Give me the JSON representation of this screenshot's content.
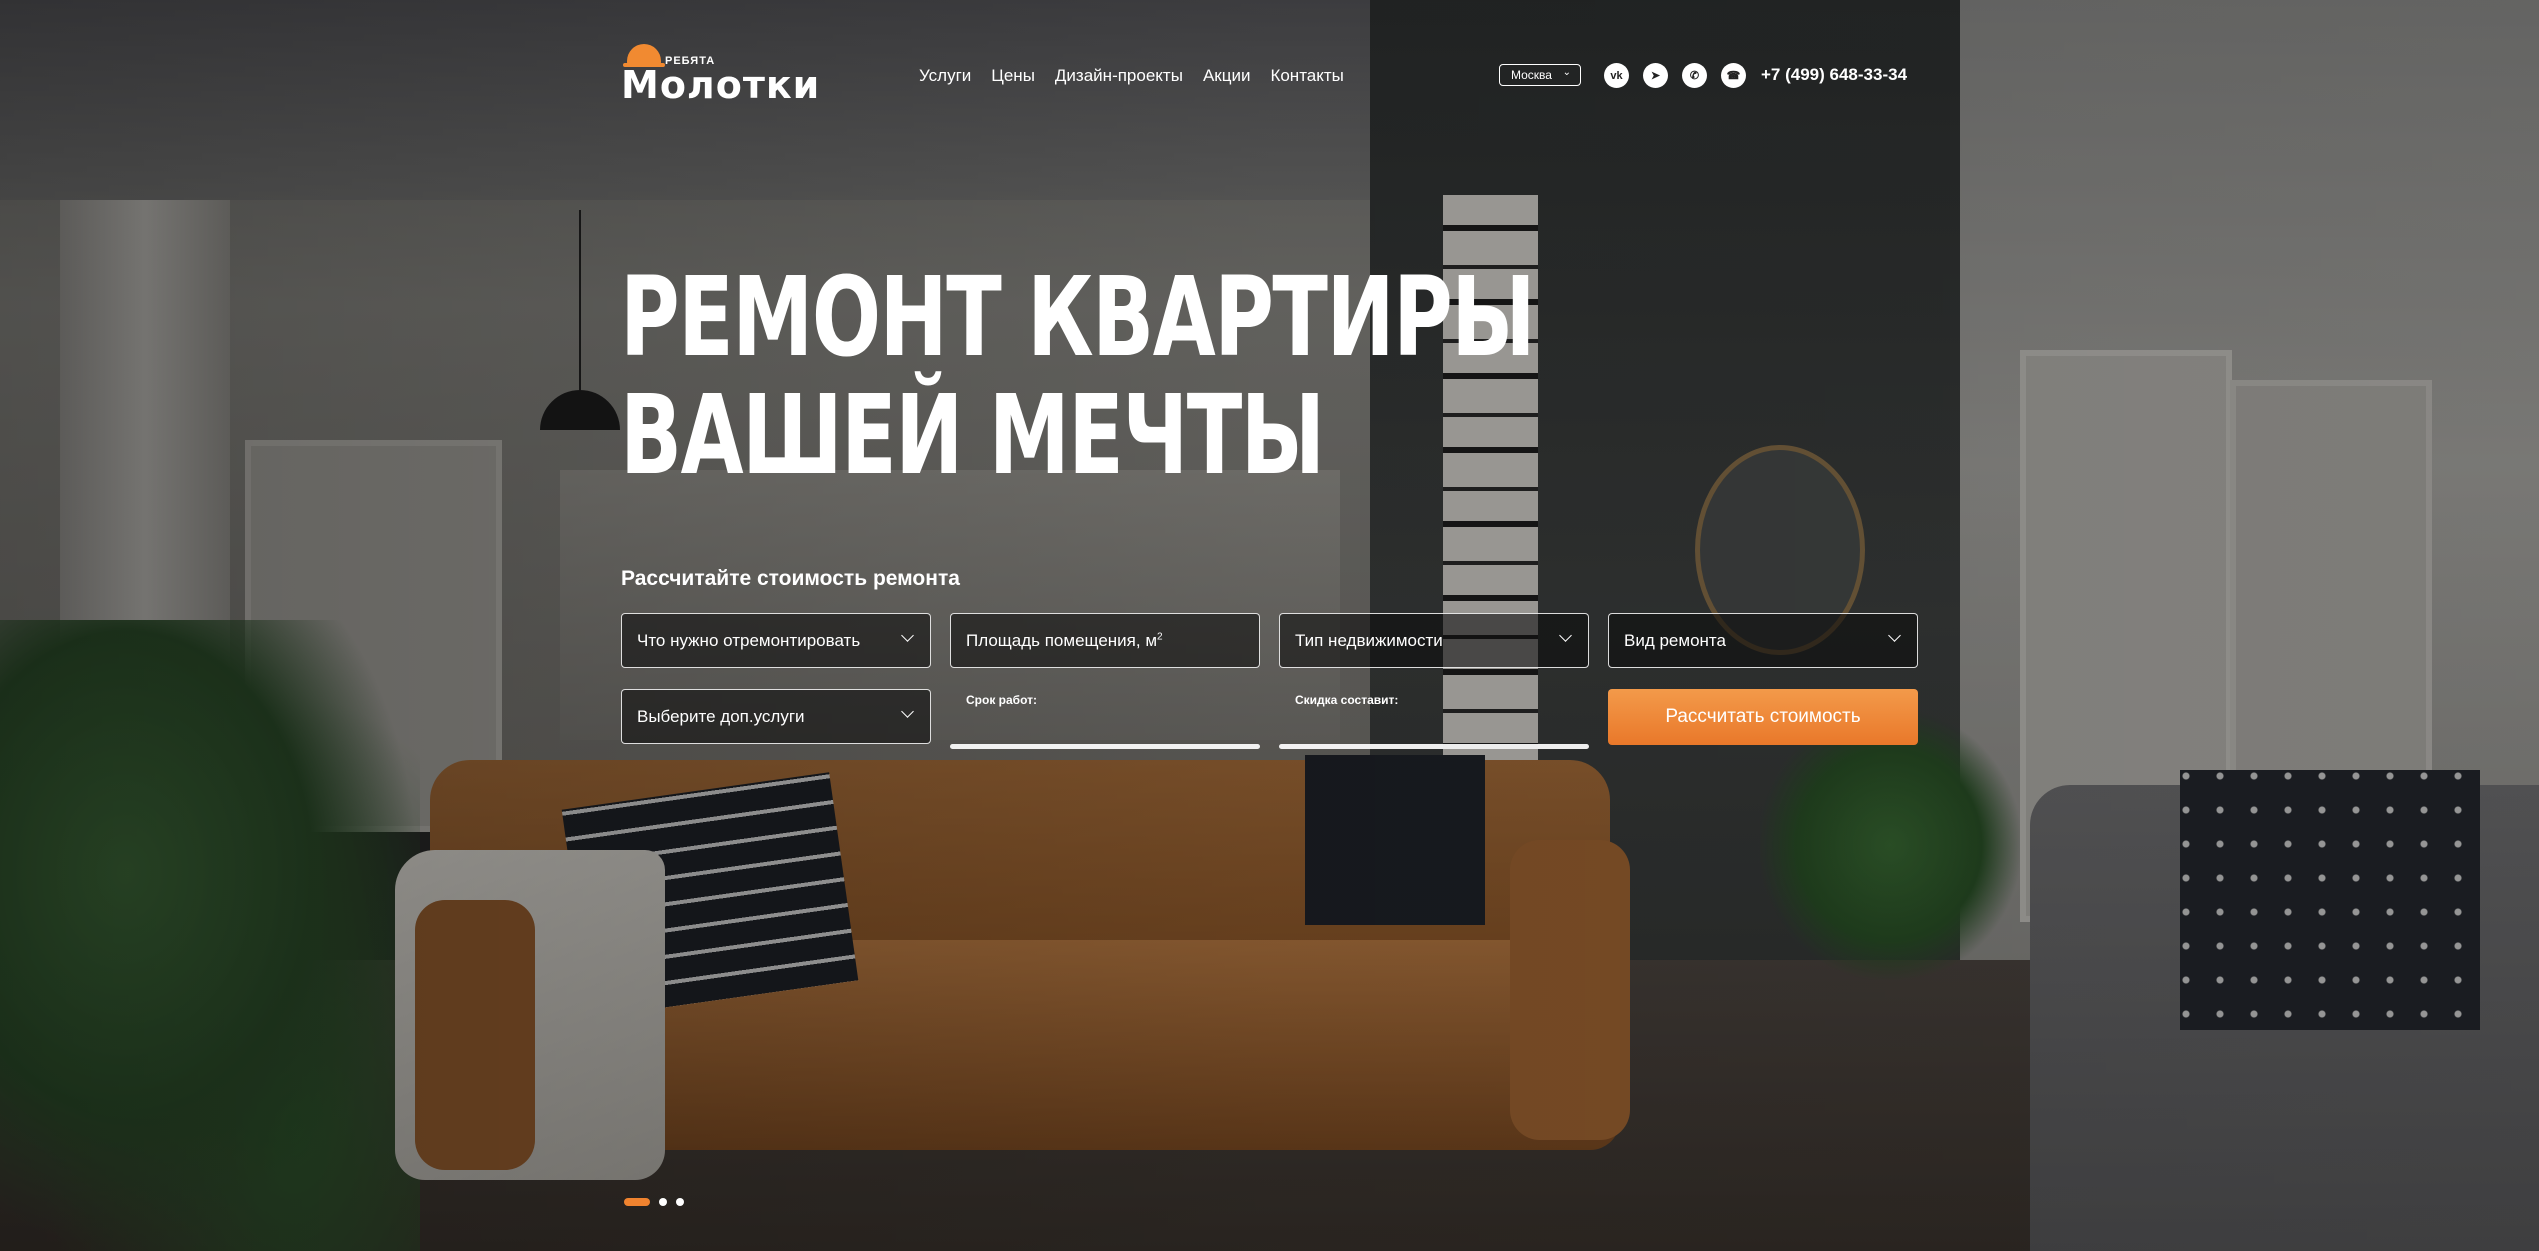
{
  "brand": {
    "small": "РЕБЯТА",
    "name": "Молотки",
    "accent_color": "#f0832f"
  },
  "nav": [
    {
      "label": "Услуги"
    },
    {
      "label": "Цены"
    },
    {
      "label": "Дизайн-проекты"
    },
    {
      "label": "Акции"
    },
    {
      "label": "Контакты"
    }
  ],
  "city": {
    "selected": "Москва"
  },
  "socials": [
    {
      "icon": "vk-icon",
      "glyph": "vk"
    },
    {
      "icon": "telegram-icon",
      "glyph": "➤"
    },
    {
      "icon": "whatsapp-icon",
      "glyph": "✆"
    },
    {
      "icon": "phone-icon",
      "glyph": "☎"
    }
  ],
  "phone": "+7 (499) 648-33-34",
  "hero": {
    "title_line1": "Ремонт квартиры",
    "title_line2": "вашей мечты"
  },
  "calculator": {
    "title": "Рассчитайте стоимость ремонта",
    "what_to_repair": "Что нужно отремонтировать",
    "area": "Площадь помещения, м",
    "area_sup": "2",
    "property_type": "Тип недвижимости",
    "repair_type": "Вид ремонта",
    "extra_services": "Выберите доп.услуги",
    "term_label": "Срок работ:",
    "discount_label": "Скидка составит:",
    "submit_label": "Рассчитать стоимость"
  },
  "slider": {
    "count": 3,
    "active": 1
  }
}
